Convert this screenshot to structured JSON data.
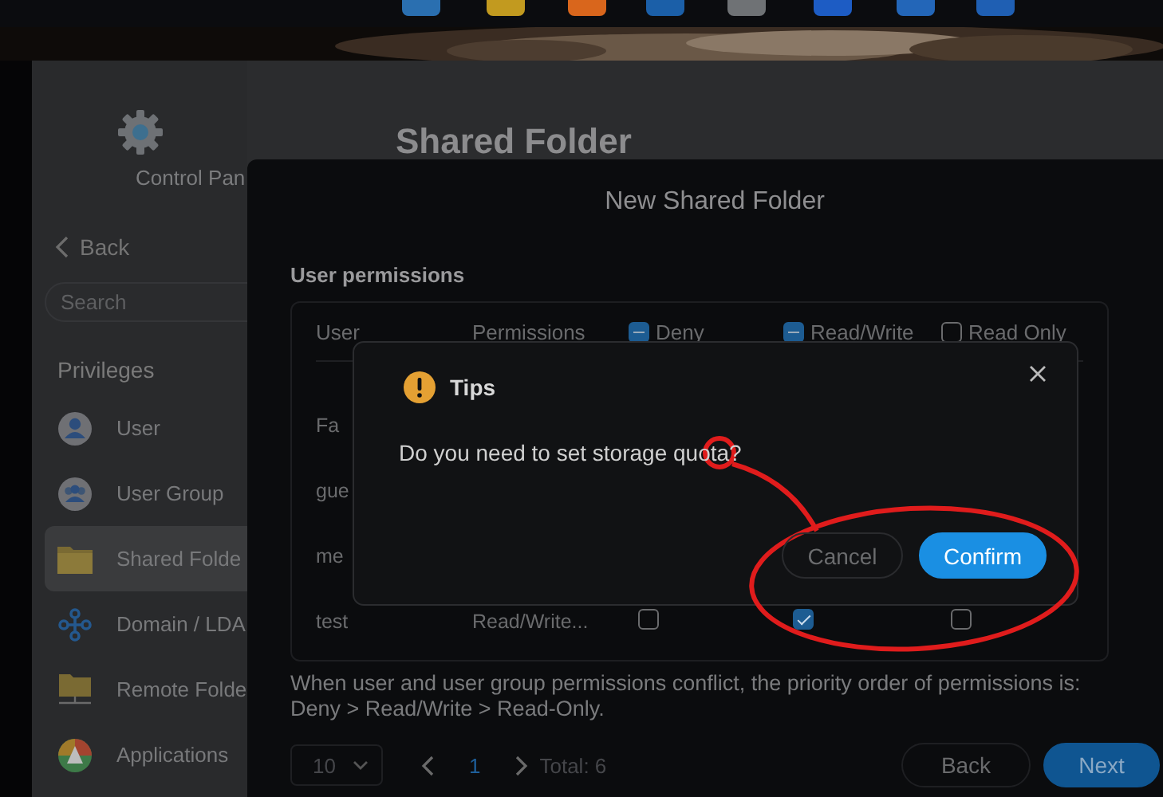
{
  "window": {
    "title": "Shared Folder",
    "sidebar": {
      "app_name": "Control Pan",
      "back": "Back",
      "search": {
        "placeholder": "Search"
      },
      "section": "Privileges",
      "items": [
        {
          "label": "User",
          "kind": "user",
          "selected": false
        },
        {
          "label": "User Group",
          "kind": "group",
          "selected": false
        },
        {
          "label": "Shared Folde",
          "kind": "folder",
          "selected": true
        },
        {
          "label": "Domain / LDA",
          "kind": "network",
          "selected": false
        },
        {
          "label": "Remote Folde",
          "kind": "remote",
          "selected": false
        },
        {
          "label": "Applications",
          "kind": "apps",
          "selected": false
        }
      ]
    }
  },
  "dialog": {
    "title": "New Shared Folder",
    "section": "User permissions",
    "table": {
      "columns": [
        {
          "label": "User",
          "kind": "text"
        },
        {
          "label": "Permissions",
          "kind": "text"
        },
        {
          "label": "Deny",
          "kind": "checkbox",
          "indeterminate": true
        },
        {
          "label": "Read/Write",
          "kind": "checkbox",
          "indeterminate": true
        },
        {
          "label": "Read Only",
          "kind": "checkbox",
          "indeterminate": false
        }
      ],
      "rows": [
        {
          "user": "Fa"
        },
        {
          "user": "gue"
        },
        {
          "user": "me"
        },
        {
          "user": "test",
          "permissions": "Read/Write...",
          "deny": false,
          "read_write": true,
          "read_only": false
        }
      ]
    },
    "note": "When user and user group permissions conflict, the priority order of permissions is: Deny > Read/Write > Read-Only.",
    "pager": {
      "page_size": "10",
      "pages": [
        {
          "label": "1",
          "selected": true
        }
      ],
      "total": "Total: 6"
    },
    "buttons": [
      {
        "label": "Back",
        "kind": "secondary"
      },
      {
        "label": "Next",
        "kind": "primary"
      }
    ]
  },
  "tips": {
    "title": "Tips",
    "message": "Do you need to set storage quota?",
    "buttons": [
      {
        "label": "Cancel",
        "kind": "secondary"
      },
      {
        "label": "Confirm",
        "kind": "primary"
      }
    ]
  }
}
